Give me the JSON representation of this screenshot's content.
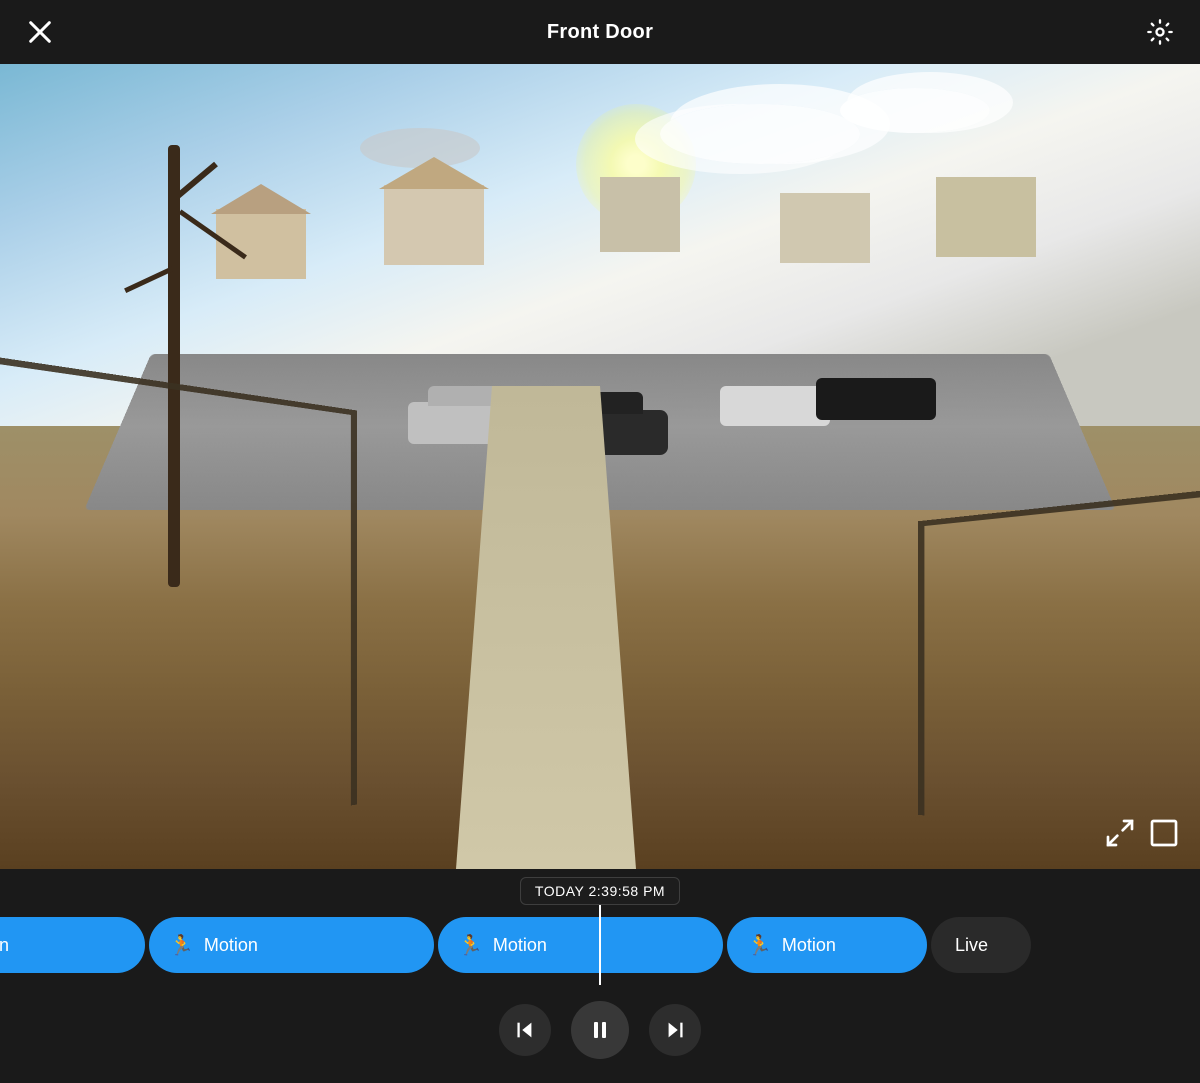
{
  "header": {
    "title": "Front Door",
    "close_label": "close",
    "settings_label": "settings"
  },
  "video": {
    "timestamp": "TODAY 2:39:58 PM"
  },
  "timeline": {
    "clips": [
      {
        "id": "clip-partial",
        "type": "motion",
        "label": "tion",
        "partial": true
      },
      {
        "id": "clip-1",
        "type": "motion",
        "label": "Motion"
      },
      {
        "id": "clip-2",
        "type": "motion",
        "label": "Motion"
      },
      {
        "id": "clip-3",
        "type": "motion",
        "label": "Motion"
      },
      {
        "id": "clip-live",
        "type": "live",
        "label": "Live"
      }
    ]
  },
  "controls": {
    "prev_label": "previous",
    "pause_label": "pause",
    "next_label": "next"
  },
  "expand": {
    "expand_label": "expand",
    "fullscreen_label": "fullscreen"
  }
}
